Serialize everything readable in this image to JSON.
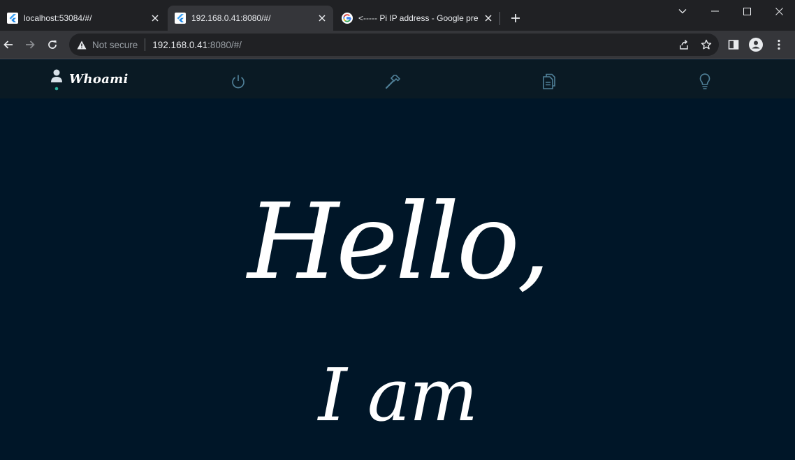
{
  "browser": {
    "tabs": [
      {
        "title": "localhost:53084/#/",
        "favicon": "flutter-icon",
        "active": false
      },
      {
        "title": "192.168.0.41:8080/#/",
        "favicon": "flutter-icon",
        "active": true
      },
      {
        "title": "<----- Pi IP address - Google pre",
        "favicon": "google-icon",
        "active": false
      }
    ],
    "address": {
      "security_label": "Not secure",
      "host": "192.168.0.41",
      "path": ":8080/#/"
    },
    "colors": {
      "tabstrip": "#202124",
      "toolbar": "#35363a",
      "omnibox": "#202124"
    }
  },
  "app": {
    "brand": "Whoami",
    "nav_icons": [
      "power-icon",
      "hammer-icon",
      "documents-icon",
      "lightbulb-icon"
    ],
    "hero": {
      "line1": "Hello,",
      "line2": "I am"
    },
    "colors": {
      "background": "#001628",
      "nav_background": "#0a1a24",
      "accent": "#2bb5a0",
      "icon": "#4f7f97"
    }
  }
}
